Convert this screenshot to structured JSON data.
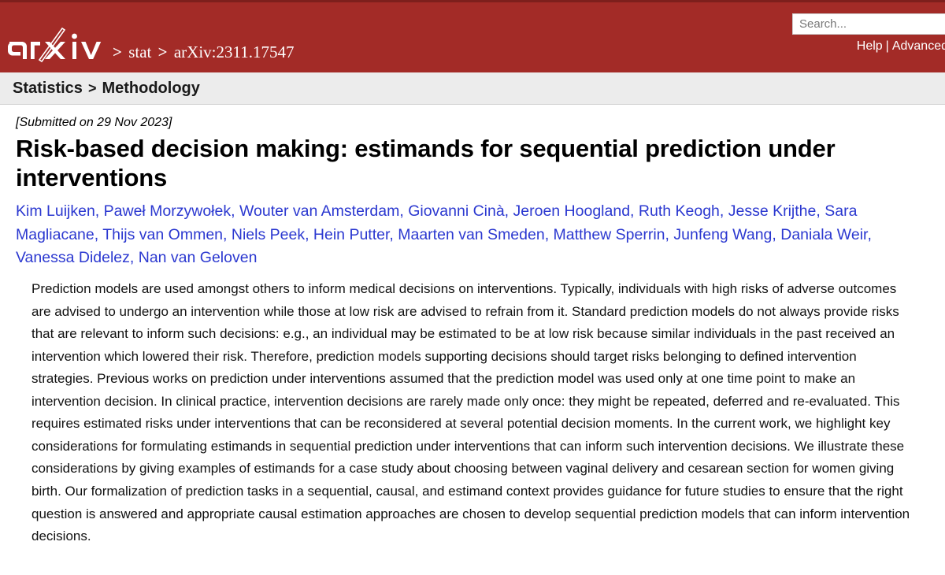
{
  "header": {
    "logo_text": "arXiv",
    "logo_icon": "arxiv-logo-icon",
    "breadcrumb": {
      "separator": ">",
      "archive": "stat",
      "identifier": "arXiv:2311.17547"
    },
    "search": {
      "placeholder": "Search...",
      "value": ""
    },
    "help_label": "Help",
    "divider": "|",
    "advanced_label": "Advanced",
    "banner_color": "#a32b27"
  },
  "subject": {
    "primary": "Statistics",
    "arrow": ">",
    "secondary": "Methodology"
  },
  "paper": {
    "submitted": "[Submitted on 29 Nov 2023]",
    "title": "Risk-based decision making: estimands for sequential prediction under interventions",
    "authors": [
      "Kim Luijken",
      "Paweł Morzywołek",
      "Wouter van Amsterdam",
      "Giovanni Cinà",
      "Jeroen Hoogland",
      "Ruth Keogh",
      "Jesse Krijthe",
      "Sara Magliacane",
      "Thijs van Ommen",
      "Niels Peek",
      "Hein Putter",
      "Maarten van Smeden",
      "Matthew Sperrin",
      "Junfeng Wang",
      "Daniala Weir",
      "Vanessa Didelez",
      "Nan van Geloven"
    ],
    "author_link_color": "#2b38d0",
    "abstract": "Prediction models are used amongst others to inform medical decisions on interventions. Typically, individuals with high risks of adverse outcomes are advised to undergo an intervention while those at low risk are advised to refrain from it. Standard prediction models do not always provide risks that are relevant to inform such decisions: e.g., an individual may be estimated to be at low risk because similar individuals in the past received an intervention which lowered their risk. Therefore, prediction models supporting decisions should target risks belonging to defined intervention strategies. Previous works on prediction under interventions assumed that the prediction model was used only at one time point to make an intervention decision. In clinical practice, intervention decisions are rarely made only once: they might be repeated, deferred and re-evaluated. This requires estimated risks under interventions that can be reconsidered at several potential decision moments. In the current work, we highlight key considerations for formulating estimands in sequential prediction under interventions that can inform such intervention decisions. We illustrate these considerations by giving examples of estimands for a case study about choosing between vaginal delivery and cesarean section for women giving birth. Our formalization of prediction tasks in a sequential, causal, and estimand context provides guidance for future studies to ensure that the right question is answered and appropriate causal estimation approaches are chosen to develop sequential prediction models that can inform intervention decisions."
  }
}
